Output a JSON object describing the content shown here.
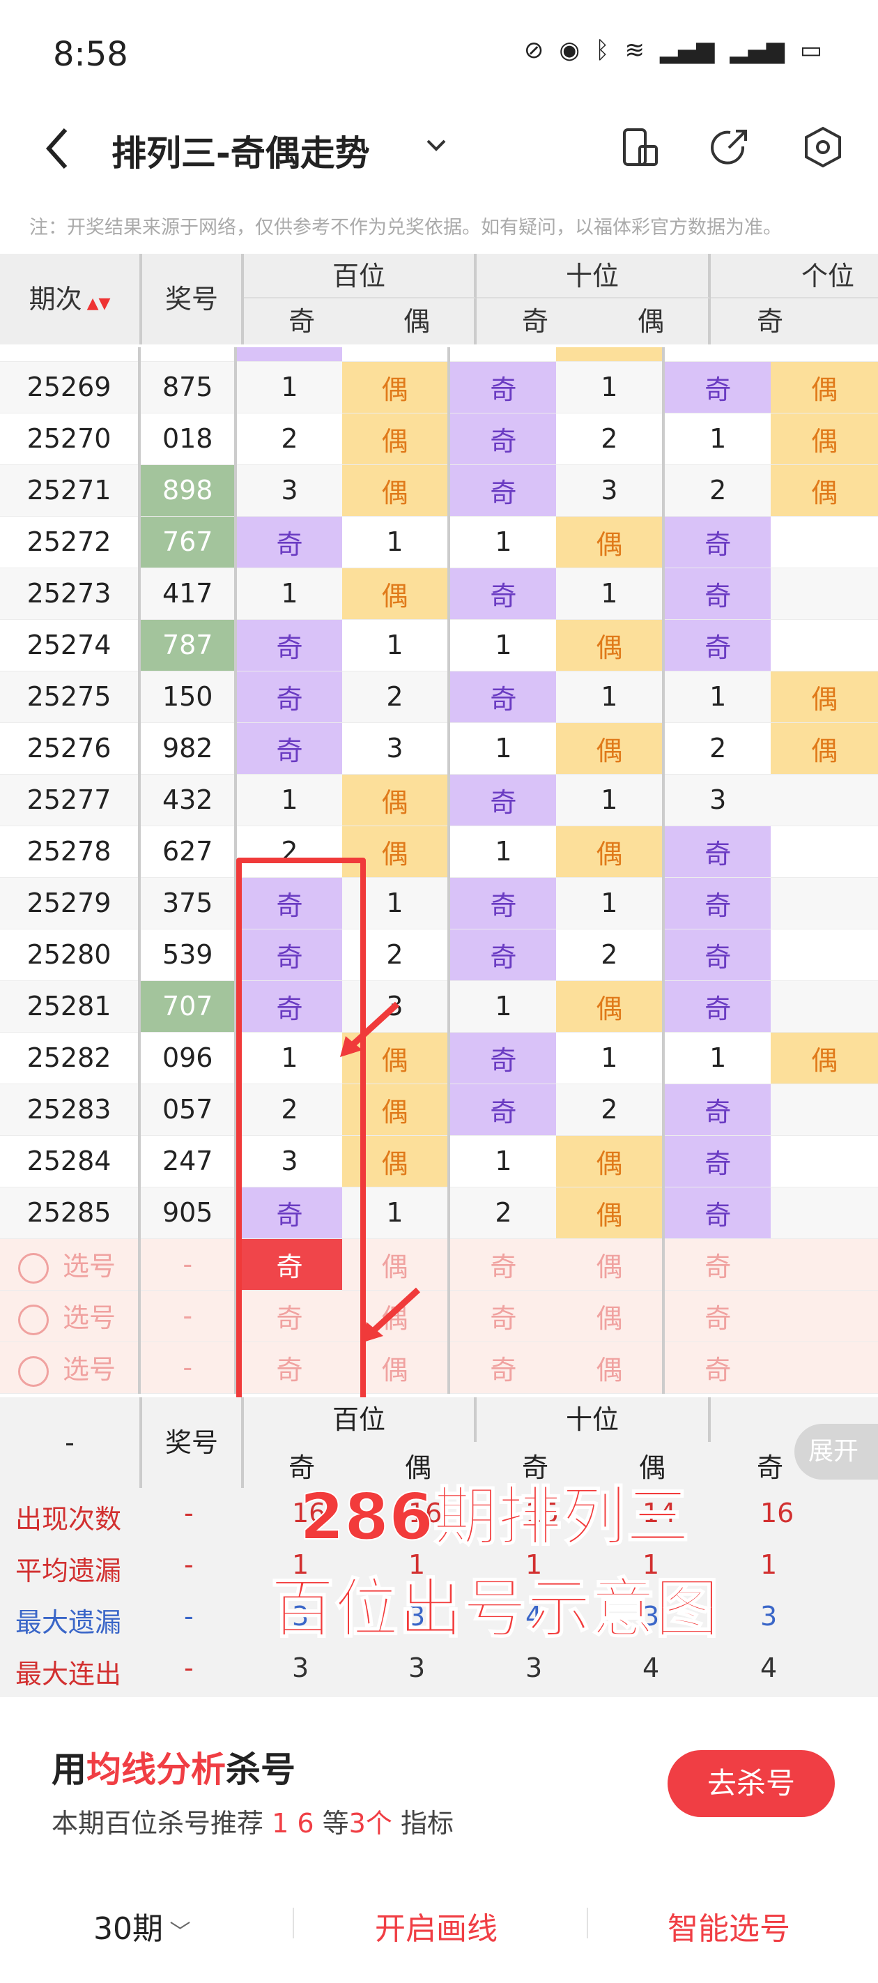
{
  "status": {
    "time": "8:58",
    "icons": [
      "mute-icon",
      "eye-icon",
      "bluetooth-icon",
      "wifi-icon",
      "signal-icon",
      "signal-icon",
      "battery-icon"
    ]
  },
  "nav": {
    "title": "排列三-奇偶走势",
    "back": "back-icon",
    "dropdown": "chevron-down-icon",
    "icons": [
      "phone-screen-icon",
      "share-icon",
      "settings-icon"
    ]
  },
  "notice": "注：开奖结果来源于网络，仅供参考不作为兑奖依据。如有疑问，以福体彩官方数据为准。",
  "header": {
    "period": "期次",
    "number": "奖号",
    "hundreds": "百位",
    "tens": "十位",
    "units": "个位",
    "odd": "奇",
    "even": "偶"
  },
  "rows": [
    [
      "25269",
      "875",
      false,
      [
        "1",
        "偶",
        "奇",
        "1",
        "奇"
      ]
    ],
    [
      "25270",
      "018",
      false,
      [
        "2",
        "偶",
        "奇",
        "2",
        "1"
      ]
    ],
    [
      "25271",
      "898",
      true,
      [
        "3",
        "偶",
        "奇",
        "3",
        "2"
      ]
    ],
    [
      "25272",
      "767",
      true,
      [
        "奇",
        "1",
        "1",
        "偶",
        "奇"
      ]
    ],
    [
      "25273",
      "417",
      false,
      [
        "1",
        "偶",
        "奇",
        "1",
        "奇"
      ]
    ],
    [
      "25274",
      "787",
      true,
      [
        "奇",
        "1",
        "1",
        "偶",
        "奇"
      ]
    ],
    [
      "25275",
      "150",
      false,
      [
        "奇",
        "2",
        "奇",
        "1",
        "1"
      ]
    ],
    [
      "25276",
      "982",
      false,
      [
        "奇",
        "3",
        "1",
        "偶",
        "2"
      ]
    ],
    [
      "25277",
      "432",
      false,
      [
        "1",
        "偶",
        "奇",
        "1",
        "3"
      ]
    ],
    [
      "25278",
      "627",
      false,
      [
        "2",
        "偶",
        "1",
        "偶",
        "奇"
      ]
    ],
    [
      "25279",
      "375",
      false,
      [
        "奇",
        "1",
        "奇",
        "1",
        "奇"
      ]
    ],
    [
      "25280",
      "539",
      false,
      [
        "奇",
        "2",
        "奇",
        "2",
        "奇"
      ]
    ],
    [
      "25281",
      "707",
      true,
      [
        "奇",
        "3",
        "1",
        "偶",
        "奇"
      ]
    ],
    [
      "25282",
      "096",
      false,
      [
        "1",
        "偶",
        "奇",
        "1",
        "1"
      ]
    ],
    [
      "25283",
      "057",
      false,
      [
        "2",
        "偶",
        "奇",
        "2",
        "奇"
      ]
    ],
    [
      "25284",
      "247",
      false,
      [
        "3",
        "偶",
        "1",
        "偶",
        "奇"
      ]
    ],
    [
      "25285",
      "905",
      false,
      [
        "奇",
        "1",
        "2",
        "偶",
        "奇"
      ]
    ]
  ],
  "sixth_col": [
    "偶",
    "偶",
    "偶",
    "",
    "",
    "",
    "偶",
    "偶",
    "",
    "",
    "",
    "",
    "",
    "偶",
    "",
    "",
    ""
  ],
  "pick": {
    "label": "选号",
    "dash": "-",
    "cells": [
      "奇",
      "偶",
      "奇",
      "偶",
      "奇"
    ]
  },
  "stats": {
    "dash": "-",
    "number_label": "奖号",
    "expand": "展开",
    "rows": [
      {
        "label": "出现次数",
        "color": "#d23030",
        "values": [
          "16",
          "16",
          "15",
          "14",
          "16"
        ]
      },
      {
        "label": "平均遗漏",
        "color": "#d23030",
        "values": [
          "1",
          "1",
          "1",
          "1",
          "1"
        ]
      },
      {
        "label": "最大遗漏",
        "color": "#3a66c8",
        "values": [
          "3",
          "3",
          "4",
          "3",
          "3"
        ]
      },
      {
        "label": "最大连出",
        "color": "#d23030",
        "values": [
          "3",
          "3",
          "3",
          "4",
          "4"
        ]
      }
    ]
  },
  "overlay": {
    "line1": "286期排列三",
    "line2": "百位出号示意图"
  },
  "card": {
    "title_pre": "用",
    "title_hl": "均线分析",
    "title_post": "杀号",
    "sub_pre": "本期百位杀号推荐",
    "sub_nums": "1 6",
    "sub_mid": "等",
    "sub_count": "3个",
    "sub_post": "指标",
    "button": "去杀号"
  },
  "bottom": {
    "periods": "30期",
    "draw": "开启画线",
    "smart": "智能选号"
  },
  "colors": {
    "odd": "#d9c2f8",
    "even": "#fcdf9a",
    "winner": "#a3c49c",
    "accent": "#f03e44"
  }
}
